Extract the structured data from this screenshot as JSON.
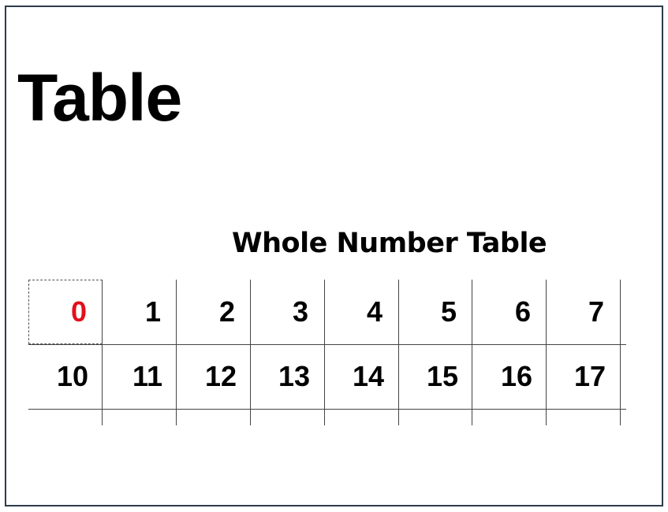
{
  "slide": {
    "title": "Table",
    "table_caption": "Whole Number Table"
  },
  "table": {
    "rows": [
      [
        "0",
        "1",
        "2",
        "3",
        "4",
        "5",
        "6",
        "7"
      ],
      [
        "10",
        "11",
        "12",
        "13",
        "14",
        "15",
        "16",
        "17"
      ]
    ],
    "highlighted_cell": "0",
    "highlight_color": "#e3101c"
  },
  "colors": {
    "frame_border": "#2e3a4a",
    "grid_line": "#444444",
    "text": "#000000"
  }
}
